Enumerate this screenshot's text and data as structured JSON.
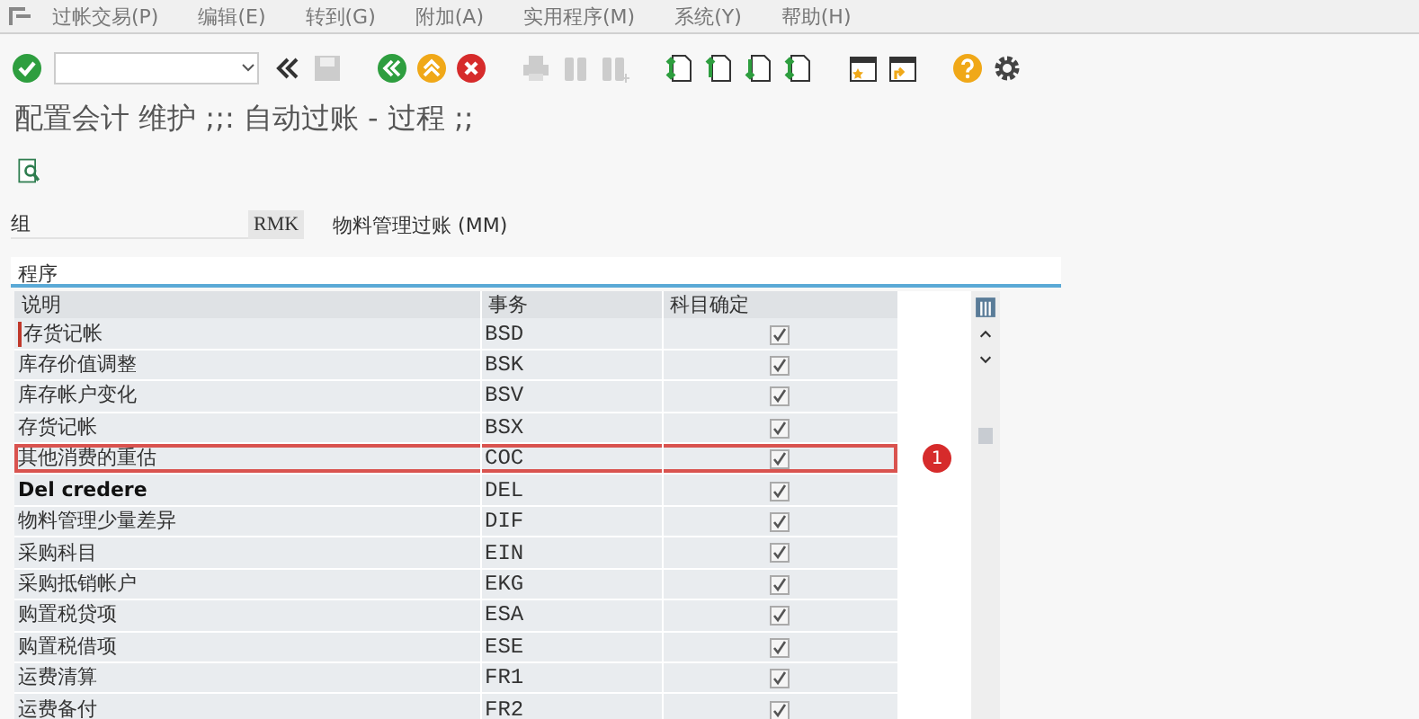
{
  "menu": [
    {
      "label": "过帐交易(P)"
    },
    {
      "label": "编辑(E)"
    },
    {
      "label": "转到(G)"
    },
    {
      "label": "附加(A)"
    },
    {
      "label": "实用程序(M)"
    },
    {
      "label": "系统(Y)"
    },
    {
      "label": "帮助(H)"
    }
  ],
  "title": "配置会计 维护 ;;: 自动过账 - 过程 ;;",
  "group": {
    "label": "组",
    "value": "RMK",
    "description": "物料管理过账 (MM)"
  },
  "section": "程序",
  "table": {
    "columns": [
      "说明",
      "事务",
      "科目确定"
    ],
    "rows": [
      {
        "description": "存货记帐",
        "code": "BSD",
        "checked": true,
        "bold": false,
        "focused": true,
        "highlighted": false
      },
      {
        "description": "库存价值调整",
        "code": "BSK",
        "checked": true,
        "bold": false,
        "focused": false,
        "highlighted": false
      },
      {
        "description": "库存帐户变化",
        "code": "BSV",
        "checked": true,
        "bold": false,
        "focused": false,
        "highlighted": false
      },
      {
        "description": "存货记帐",
        "code": "BSX",
        "checked": true,
        "bold": false,
        "focused": false,
        "highlighted": false
      },
      {
        "description": "其他消费的重估",
        "code": "COC",
        "checked": true,
        "bold": false,
        "focused": false,
        "highlighted": true
      },
      {
        "description": "Del credere",
        "code": "DEL",
        "checked": true,
        "bold": true,
        "focused": false,
        "highlighted": false
      },
      {
        "description": "物料管理少量差异",
        "code": "DIF",
        "checked": true,
        "bold": false,
        "focused": false,
        "highlighted": false
      },
      {
        "description": "采购科目",
        "code": "EIN",
        "checked": true,
        "bold": false,
        "focused": false,
        "highlighted": false
      },
      {
        "description": "采购抵销帐户",
        "code": "EKG",
        "checked": true,
        "bold": false,
        "focused": false,
        "highlighted": false
      },
      {
        "description": "购置税贷项",
        "code": "ESA",
        "checked": true,
        "bold": false,
        "focused": false,
        "highlighted": false
      },
      {
        "description": "购置税借项",
        "code": "ESE",
        "checked": true,
        "bold": false,
        "focused": false,
        "highlighted": false
      },
      {
        "description": "运费清算",
        "code": "FR1",
        "checked": true,
        "bold": false,
        "focused": false,
        "highlighted": false
      },
      {
        "description": "运费备付",
        "code": "FR2",
        "checked": true,
        "bold": false,
        "focused": false,
        "highlighted": false
      }
    ]
  },
  "callout": "1"
}
